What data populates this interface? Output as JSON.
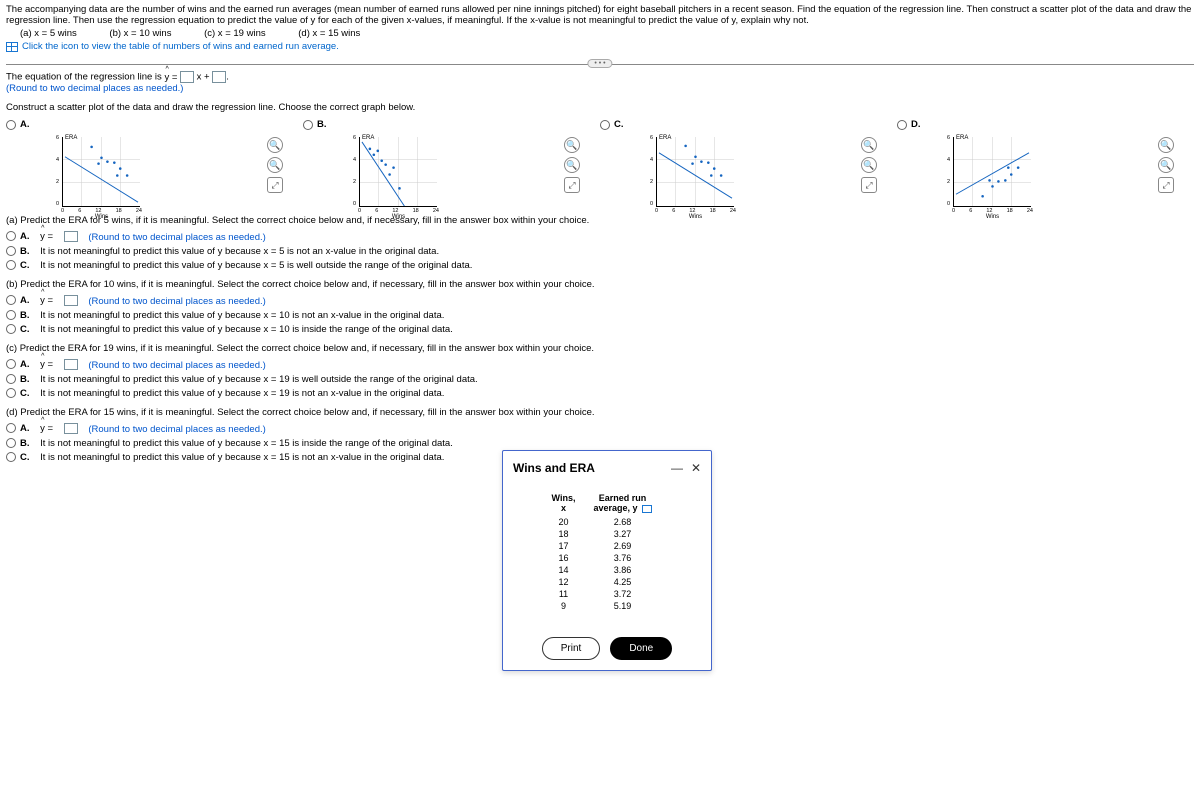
{
  "intro": "The accompanying data are the number of wins and the earned run averages (mean number of earned runs allowed per nine innings pitched) for eight baseball pitchers in a recent season. Find the equation of the regression line. Then construct a scatter plot of the data and draw the regression line. Then use the regression equation to predict the value of y for each of the given x-values, if meaningful. If the x-value is not meaningful to predict the value of y, explain why not.",
  "parts_line": {
    "a": "(a) x = 5 wins",
    "b": "(b) x = 10 wins",
    "c": "(c) x = 19 wins",
    "d": "(d) x = 15 wins"
  },
  "icon_link": "Click the icon to view the table of numbers of wins and earned run average.",
  "hr_btn": "• • •",
  "eq_pre": "The equation of the regression line is ",
  "eq_mid": "x +",
  "eq_post": ".",
  "yhat": "y =",
  "round_note": "(Round to two decimal places as needed.)",
  "construct": "Construct a scatter plot of the data and draw the regression line. Choose the correct graph below.",
  "opts": {
    "A": "A.",
    "B": "B.",
    "C": "C.",
    "D": "D."
  },
  "axis": {
    "y": "ERA",
    "x": "Wins",
    "xticks": [
      "0",
      "6",
      "12",
      "18",
      "24"
    ],
    "yticks": [
      "6",
      "4",
      "2",
      "0"
    ]
  },
  "qa": {
    "head": "(a) Predict the ERA for 5 wins, if it is meaningful. Select the correct choice below and, if necessary, fill in the answer box within your choice.",
    "A_pre": "A.",
    "A_y": "y =",
    "A_note": "(Round to two decimal places as needed.)",
    "B": "B.",
    "B_txt": "It is not meaningful to predict this value of y because x = 5 is not an x-value in the original data.",
    "C": "C.",
    "C_txt": "It is not meaningful to predict this value of y because x = 5 is well outside the range of the original data."
  },
  "qb": {
    "head": "(b) Predict the ERA for 10 wins, if it is meaningful. Select the correct choice below and, if necessary, fill in the answer box within your choice.",
    "B_txt": "It is not meaningful to predict this value of y because x = 10 is not an x-value in the original data.",
    "C_txt": "It is not meaningful to predict this value of y because x = 10 is inside the range of the original data."
  },
  "qc": {
    "head": "(c) Predict the ERA for 19 wins, if it is meaningful. Select the correct choice below and, if necessary, fill in the answer box within your choice.",
    "B_txt": "It is not meaningful to predict this value of y because x = 19 is well outside the range of the original data.",
    "C_txt": "It is not meaningful to predict this value of y because x = 19 is not an x-value in the original data."
  },
  "qd": {
    "head": "(d) Predict the ERA for 15 wins, if it is meaningful. Select the correct choice below and, if necessary, fill in the answer box within your choice.",
    "B_txt": "It is not meaningful to predict this value of y because x = 15 is inside the range of the original data.",
    "C_txt": "It is not meaningful to predict this value of y because x = 15 is not an x-value in the original data."
  },
  "popup": {
    "title": "Wins and ERA",
    "col1": "Wins, x",
    "col2": "Earned run average, y",
    "rows": [
      [
        "20",
        "2.68"
      ],
      [
        "18",
        "3.27"
      ],
      [
        "17",
        "2.69"
      ],
      [
        "16",
        "3.76"
      ],
      [
        "14",
        "3.86"
      ],
      [
        "12",
        "4.25"
      ],
      [
        "11",
        "3.72"
      ],
      [
        "9",
        "5.19"
      ]
    ],
    "print": "Print",
    "done": "Done"
  },
  "chart_data": {
    "type": "scatter",
    "x": [
      20,
      18,
      17,
      16,
      14,
      12,
      11,
      9
    ],
    "y": [
      2.68,
      3.27,
      2.69,
      3.76,
      3.86,
      4.25,
      3.72,
      5.19
    ],
    "xlabel": "Wins",
    "ylabel": "ERA",
    "xlim": [
      0,
      24
    ],
    "ylim": [
      0,
      6
    ],
    "variants": {
      "A": {
        "line": [
          [
            0,
            4.2
          ],
          [
            24,
            0.4
          ]
        ],
        "desc": "points descending, line descending through points"
      },
      "B": {
        "line": [
          [
            0,
            5.6
          ],
          [
            14,
            0
          ]
        ],
        "desc": "steeper descending line"
      },
      "C": {
        "line": [
          [
            0,
            4.6
          ],
          [
            24,
            0.5
          ]
        ],
        "desc": "descending line, points slightly higher"
      },
      "D": {
        "line": [
          [
            0,
            1.0
          ],
          [
            24,
            4.6
          ]
        ],
        "desc": "ascending line"
      }
    }
  }
}
